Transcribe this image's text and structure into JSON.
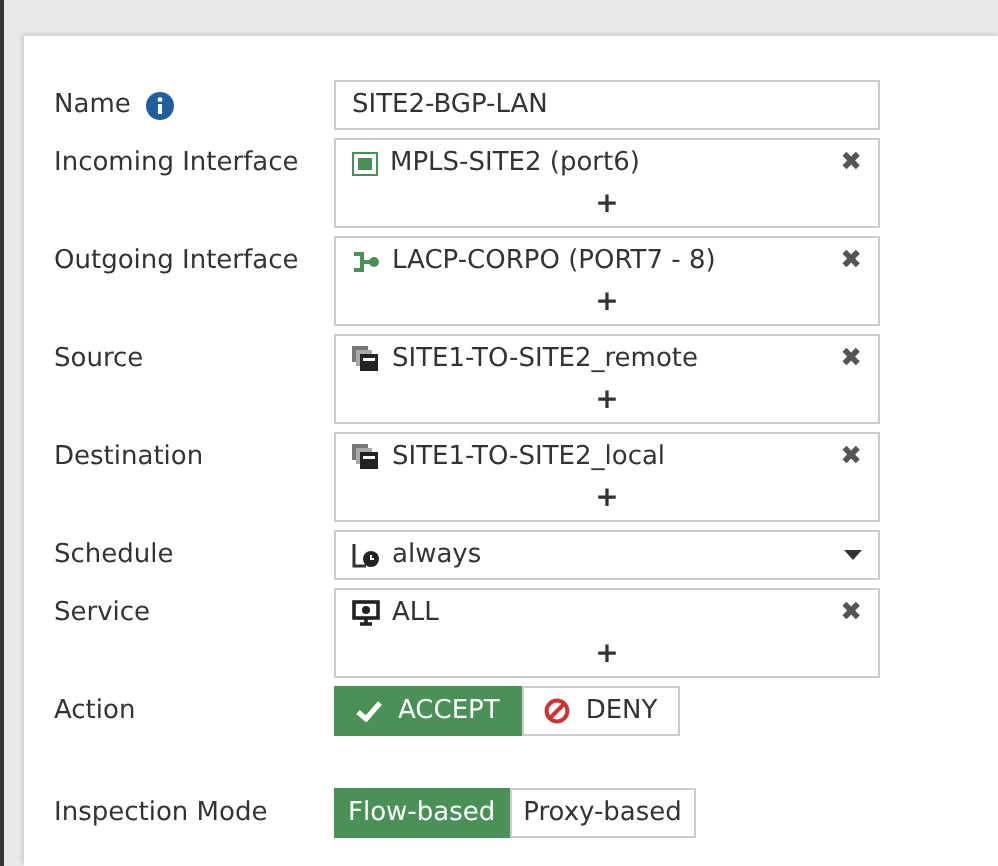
{
  "fields": [
    {
      "kind": "text",
      "label": "Name",
      "info": true,
      "value": "SITE2-BGP-LAN"
    },
    {
      "kind": "multi",
      "label": "Incoming Interface",
      "items": [
        {
          "kind": "port",
          "text": "MPLS-SITE2 (port6)"
        }
      ],
      "add": "+",
      "remove": "✖"
    },
    {
      "kind": "multi",
      "label": "Outgoing Interface",
      "items": [
        {
          "kind": "aggregate",
          "text": "LACP-CORPO (PORT7 - 8)"
        }
      ],
      "add": "+",
      "remove": "✖"
    },
    {
      "kind": "multi",
      "label": "Source",
      "items": [
        {
          "kind": "address",
          "text": "SITE1-TO-SITE2_remote"
        }
      ],
      "add": "+",
      "remove": "✖"
    },
    {
      "kind": "multi",
      "label": "Destination",
      "items": [
        {
          "kind": "address",
          "text": "SITE1-TO-SITE2_local"
        }
      ],
      "add": "+",
      "remove": "✖"
    },
    {
      "kind": "select",
      "label": "Schedule",
      "items": [
        {
          "kind": "schedule",
          "text": "always"
        }
      ]
    },
    {
      "kind": "multi",
      "label": "Service",
      "items": [
        {
          "kind": "service",
          "text": "ALL"
        }
      ],
      "add": "+",
      "remove": "✖"
    },
    {
      "kind": "toggle",
      "label": "Action",
      "options": [
        {
          "kind": "accept",
          "text": "ACCEPT",
          "selected": true
        },
        {
          "kind": "deny",
          "text": "DENY",
          "selected": false
        }
      ]
    },
    {
      "kind": "toggle",
      "label": "Inspection Mode",
      "options": [
        {
          "text": "Flow-based",
          "selected": true
        },
        {
          "text": "Proxy-based",
          "selected": false
        }
      ]
    }
  ]
}
